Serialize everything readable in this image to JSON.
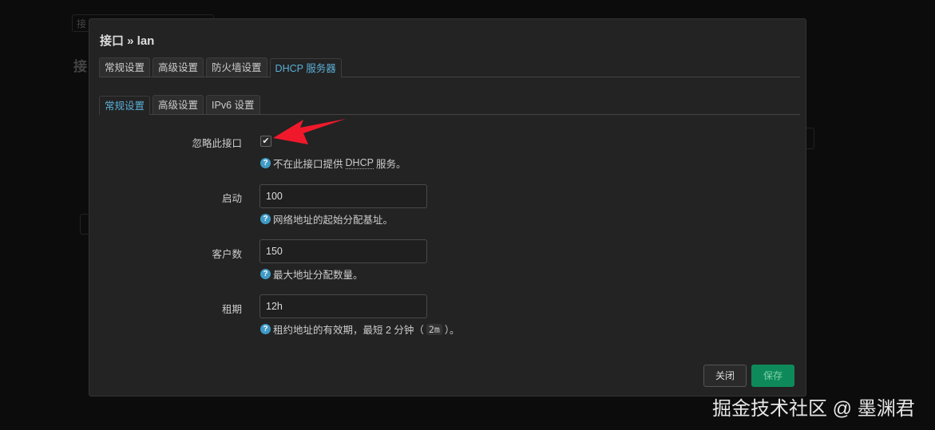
{
  "background": {
    "tab_char": "接",
    "heading_char": "接"
  },
  "modal": {
    "title": "接口 » lan",
    "tabs": [
      {
        "label": "常规设置"
      },
      {
        "label": "高级设置"
      },
      {
        "label": "防火墙设置"
      },
      {
        "label": "DHCP 服务器"
      }
    ],
    "subtabs": [
      {
        "label": "常规设置"
      },
      {
        "label": "高级设置"
      },
      {
        "label": "IPv6 设置"
      }
    ],
    "ignore": {
      "label": "忽略此接口",
      "checked": true,
      "help_pre": "不在此接口提供 ",
      "help_abbr": "DHCP",
      "help_post": " 服务。"
    },
    "start": {
      "label": "启动",
      "value": "100",
      "help": "网络地址的起始分配基址。"
    },
    "limit": {
      "label": "客户数",
      "value": "150",
      "help": "最大地址分配数量。"
    },
    "lease": {
      "label": "租期",
      "value": "12h",
      "help_pre": "租约地址的有效期，最短 2 分钟（",
      "help_code": "2m",
      "help_post": "）。"
    },
    "close_label": "关闭",
    "save_label": "保存",
    "help_icon": "?"
  },
  "watermark": "掘金技术社区 @ 墨渊君",
  "colors": {
    "accent": "#5aaed6",
    "save": "#0e8a5a",
    "arrow": "#f0192b"
  }
}
